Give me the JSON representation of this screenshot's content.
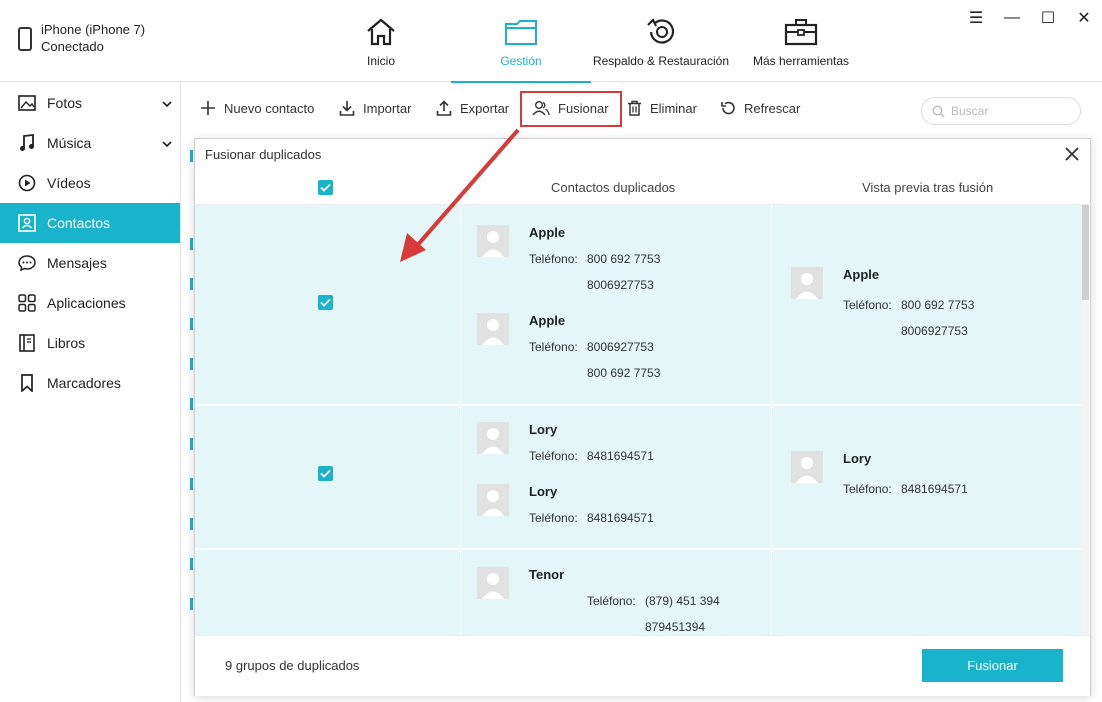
{
  "device": {
    "name": "iPhone (iPhone 7)",
    "status": "Conectado"
  },
  "nav": [
    {
      "label": "Inicio",
      "icon": "home-icon"
    },
    {
      "label": "Gestión",
      "icon": "folder-icon",
      "active": true
    },
    {
      "label": "Respaldo & Restauración",
      "icon": "backup-restore-icon"
    },
    {
      "label": "Más herramientas",
      "icon": "toolbox-icon"
    }
  ],
  "sidebar": {
    "items": [
      {
        "label": "Fotos"
      },
      {
        "label": "Música"
      },
      {
        "label": "Vídeos"
      },
      {
        "label": "Contactos",
        "active": true
      },
      {
        "label": "Mensajes"
      },
      {
        "label": "Aplicaciones"
      },
      {
        "label": "Libros"
      },
      {
        "label": "Marcadores"
      }
    ]
  },
  "toolbar": {
    "new_contact": "Nuevo contacto",
    "import": "Importar",
    "export": "Exportar",
    "merge": "Fusionar",
    "delete": "Eliminar",
    "refresh": "Refrescar",
    "search_placeholder": "Buscar"
  },
  "modal": {
    "title": "Fusionar duplicados",
    "col_duplicates": "Contactos duplicados",
    "col_preview": "Vista previa tras fusión",
    "groups": [
      {
        "checked": true,
        "duplicates": [
          {
            "name": "Apple",
            "phone_label": "Teléfono:",
            "phones": [
              "800 692 7753",
              "8006927753"
            ]
          },
          {
            "name": "Apple",
            "phone_label": "Teléfono:",
            "phones": [
              "8006927753",
              "800 692 7753"
            ]
          }
        ],
        "preview": {
          "name": "Apple",
          "phone_label": "Teléfono:",
          "phones": [
            "800 692 7753",
            "8006927753"
          ]
        }
      },
      {
        "checked": true,
        "duplicates": [
          {
            "name": "Lory",
            "phone_label": "Teléfono:",
            "phones": [
              "8481694571"
            ]
          },
          {
            "name": "Lory",
            "phone_label": "Teléfono:",
            "phones": [
              "8481694571"
            ]
          }
        ],
        "preview": {
          "name": "Lory",
          "phone_label": "Teléfono:",
          "phones": [
            "8481694571"
          ]
        }
      },
      {
        "checked": true,
        "duplicates": [
          {
            "name": "Tenor",
            "phone_label": "Teléfono:",
            "phones": [
              "(879) 451 394",
              "879451394"
            ]
          }
        ]
      }
    ],
    "count_text": "9 grupos de duplicados",
    "merge_button": "Fusionar"
  },
  "colors": {
    "accent": "#1ab3cc",
    "row_bg": "#e4f6f8",
    "highlight": "#d83a3a"
  }
}
